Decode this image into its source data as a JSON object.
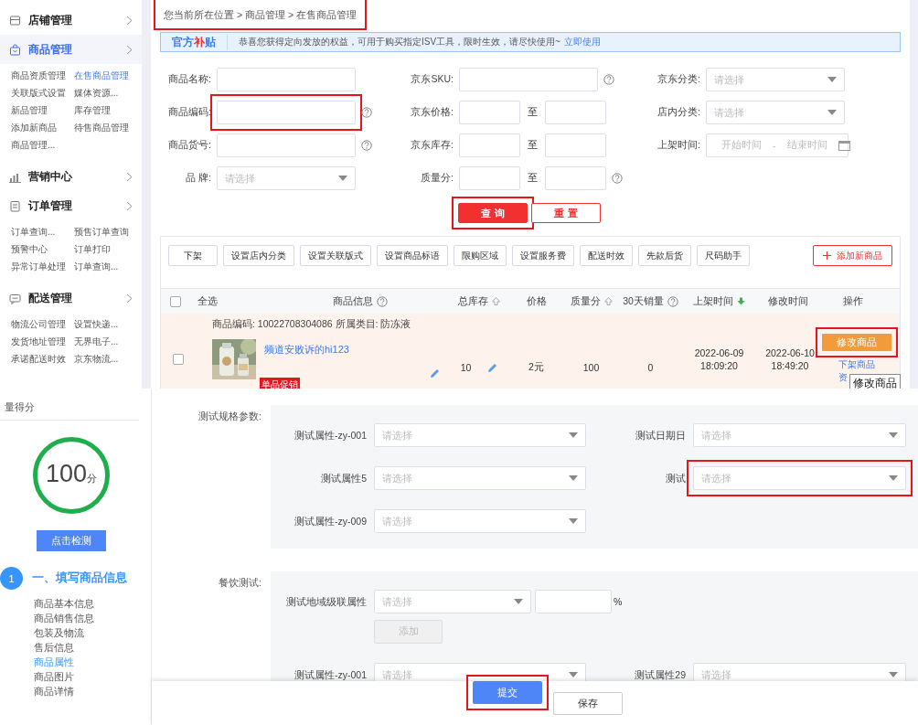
{
  "sidebar": {
    "groups": [
      {
        "title": "店铺管理",
        "selected": false
      },
      {
        "title": "商品管理",
        "selected": true,
        "items": [
          {
            "label": "商品资质管理",
            "selected": false
          },
          {
            "label": "在售商品管理",
            "selected": true
          },
          {
            "label": "关联版式设置",
            "selected": false
          },
          {
            "label": "媒体资源...",
            "selected": false
          },
          {
            "label": "新品管理",
            "selected": false
          },
          {
            "label": "库存管理",
            "selected": false
          },
          {
            "label": "添加新商品",
            "selected": false
          },
          {
            "label": "待售商品管理",
            "selected": false
          },
          {
            "label": "商品管理...",
            "selected": false
          }
        ]
      },
      {
        "title": "营销中心",
        "selected": false
      },
      {
        "title": "订单管理",
        "selected": false,
        "items": [
          {
            "label": "订单查询...",
            "selected": false
          },
          {
            "label": "预售订单查询",
            "selected": false
          },
          {
            "label": "预警中心",
            "selected": false
          },
          {
            "label": "订单打印",
            "selected": false
          },
          {
            "label": "异常订单处理",
            "selected": false
          },
          {
            "label": "订单查询...",
            "selected": false
          }
        ]
      },
      {
        "title": "配送管理",
        "selected": false,
        "items": [
          {
            "label": "物流公司管理",
            "selected": false
          },
          {
            "label": "设置快递...",
            "selected": false
          },
          {
            "label": "发货地址管理",
            "selected": false
          },
          {
            "label": "无界电子...",
            "selected": false
          },
          {
            "label": "承诺配送时效",
            "selected": false
          },
          {
            "label": "京东物流...",
            "selected": false
          }
        ]
      }
    ]
  },
  "breadcrumb": {
    "text": "您当前所在位置 > 商品管理 > 在售商品管理",
    "highlighted": true
  },
  "banner": {
    "badge": [
      {
        "text": "官方",
        "color": "#3a7ef0"
      },
      {
        "text": "补",
        "color": "#f23030"
      },
      {
        "text": "贴",
        "color": "#3a7ef0"
      }
    ],
    "message": "恭喜您获得定向发放的权益，可用于购买指定ISV工具，限时生效，请尽快使用~",
    "link": "立即使用"
  },
  "filters": [
    [
      {
        "label": "商品名称:",
        "kind": "text",
        "help": false,
        "highlighted": false
      },
      {
        "label": "京东SKU:",
        "kind": "text",
        "help": true,
        "highlighted": false
      },
      {
        "label": "京东分类:",
        "kind": "select",
        "placeholder": "请选择",
        "help": false,
        "highlighted": false
      }
    ],
    [
      {
        "label": "商品编码:",
        "kind": "text",
        "help": true,
        "highlighted": true
      },
      {
        "label": "京东价格:",
        "kind": "range",
        "separator": "至",
        "help": false,
        "highlighted": false
      },
      {
        "label": "店内分类:",
        "kind": "select",
        "placeholder": "请选择",
        "help": false,
        "highlighted": false
      }
    ],
    [
      {
        "label": "商品货号:",
        "kind": "text",
        "help": true,
        "highlighted": false
      },
      {
        "label": "京东库存:",
        "kind": "range",
        "separator": "至",
        "help": false,
        "highlighted": false
      },
      {
        "label": "上架时间:",
        "kind": "daterange",
        "start_placeholder": "开始时间",
        "separator": "-",
        "end_placeholder": "结束时间",
        "help": false,
        "highlighted": false
      }
    ],
    [
      {
        "label": "品 牌:",
        "kind": "select",
        "placeholder": "请选择",
        "help": false,
        "highlighted": false
      },
      {
        "label": "质量分:",
        "kind": "range",
        "separator": "至",
        "help": true,
        "highlighted": false
      }
    ]
  ],
  "search_buttons": [
    {
      "label": "查 询",
      "kind": "primary",
      "highlighted": true
    },
    {
      "label": "重 置",
      "kind": "outline",
      "highlighted": false
    }
  ],
  "toolbar": {
    "actions": [
      "下架",
      "设置店内分类",
      "设置关联版式",
      "设置商品标语",
      "限购区域",
      "设置服务费",
      "配送时效",
      "先款后货",
      "尺码助手"
    ],
    "add_button": "添加新商品"
  },
  "table": {
    "select_all": {
      "label": "全选",
      "checked": false
    },
    "columns": [
      {
        "label": "商品信息",
        "help": true,
        "sortable": false
      },
      {
        "label": "总库存",
        "help": false,
        "sortable": true,
        "sorted": false
      },
      {
        "label": "价格",
        "help": false,
        "sortable": false
      },
      {
        "label": "质量分",
        "help": false,
        "sortable": true,
        "sorted": false
      },
      {
        "label": "30天销量",
        "help": true,
        "sortable": false
      },
      {
        "label": "上架时间",
        "help": false,
        "sortable": true,
        "sorted": true
      },
      {
        "label": "修改时间",
        "help": false,
        "sortable": false
      },
      {
        "label": "操作",
        "help": false,
        "sortable": false
      }
    ],
    "rows": [
      {
        "checked": false,
        "meta": "商品编码:  10022708304086 所属类目: 防冻液",
        "title": "频道安败诉的hi123",
        "tag": "单品促销",
        "stock": "10",
        "price": "2元",
        "quality": "100",
        "sales": "0",
        "listed": "2022-06-09 18:09:20",
        "modified": "2022-06-10 18:49:20",
        "edit_button": {
          "label": "修改商品",
          "highlighted": true
        },
        "links": [
          "下架商品",
          "资"
        ],
        "tooltip": "修改商品"
      }
    ]
  },
  "quality": {
    "caption": "量得分",
    "score": "100",
    "unit": "分",
    "button": "点击检测"
  },
  "steps": [
    {
      "number": "1",
      "title": "一、填写商品信息",
      "items": [
        {
          "label": "商品基本信息",
          "selected": false
        },
        {
          "label": "商品销售信息",
          "selected": false
        },
        {
          "label": "包装及物流",
          "selected": false
        },
        {
          "label": "售后信息",
          "selected": false
        },
        {
          "label": "商品属性",
          "selected": true
        },
        {
          "label": "商品图片",
          "selected": false
        },
        {
          "label": "商品详情",
          "selected": false
        }
      ]
    }
  ],
  "attributes": {
    "sections": [
      {
        "label": "测试规格参数:",
        "rows": [
          [
            {
              "kind": "select",
              "label": "测试属性-zy-001",
              "placeholder": "请选择",
              "highlighted": false
            },
            {
              "kind": "select",
              "label": "测试日期日",
              "placeholder": "请选择",
              "highlighted": false
            }
          ],
          [
            {
              "kind": "select",
              "label": "测试属性5",
              "placeholder": "请选择",
              "highlighted": false
            },
            {
              "kind": "select",
              "label": "测试",
              "placeholder": "请选择",
              "highlighted": true
            }
          ],
          [
            {
              "kind": "select",
              "label": "测试属性-zy-009",
              "placeholder": "请选择",
              "highlighted": false
            }
          ]
        ]
      },
      {
        "label": "餐饮测试:",
        "rows": [
          [
            {
              "kind": "cascade",
              "label": "测试地域级联属性",
              "placeholder": "请选择",
              "unit": "%",
              "add_button": {
                "label": "添加",
                "disabled": true
              },
              "highlighted": false
            }
          ],
          [
            {
              "kind": "select",
              "label": "测试属性-zy-001",
              "placeholder": "请选择",
              "highlighted": false
            },
            {
              "kind": "select",
              "label": "测试属性29",
              "placeholder": "请选择",
              "highlighted": false
            }
          ]
        ]
      }
    ]
  },
  "footer": [
    {
      "label": "提交",
      "kind": "primary",
      "highlighted": true
    },
    {
      "label": "保存",
      "kind": "default",
      "highlighted": false
    }
  ]
}
